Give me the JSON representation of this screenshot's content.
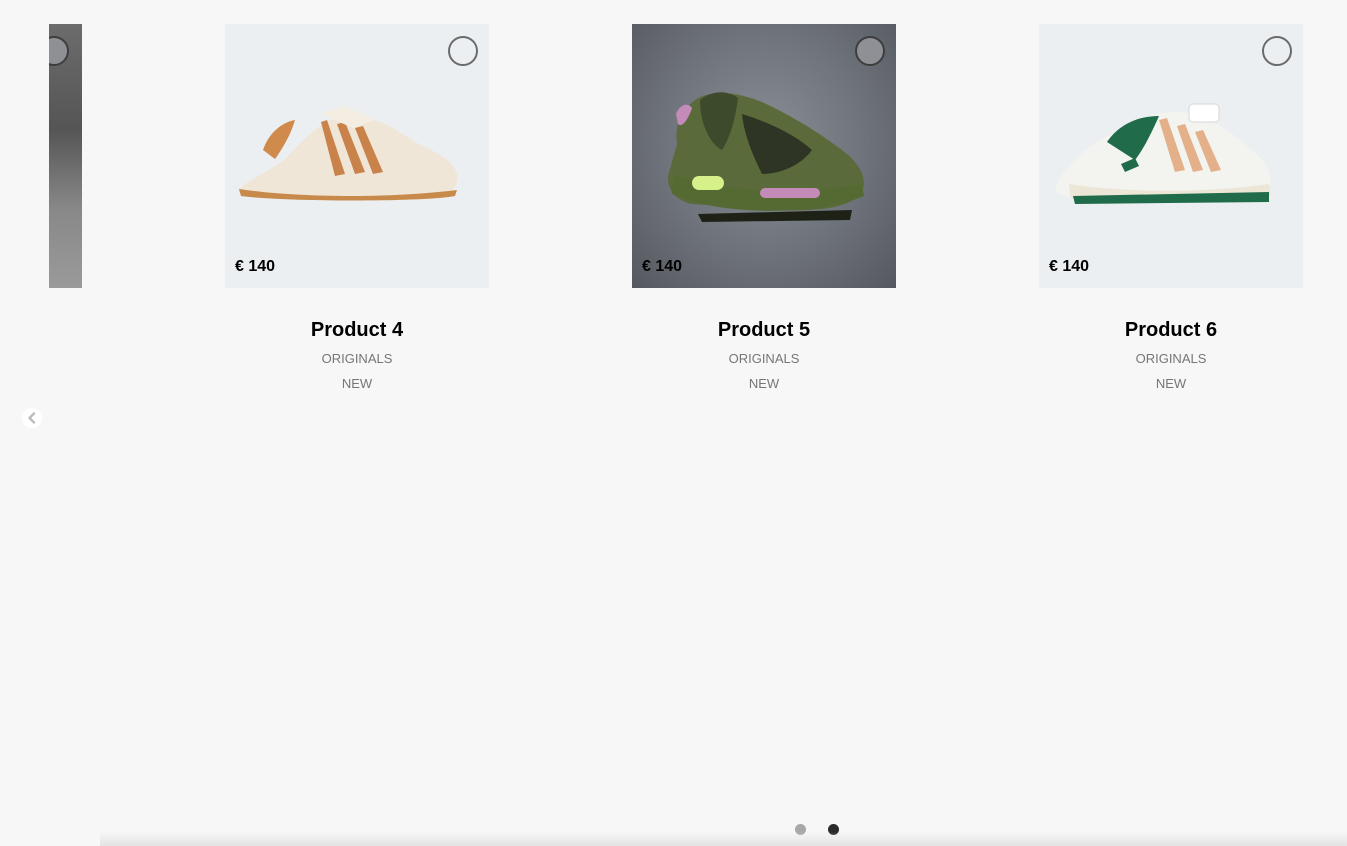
{
  "products": [
    {
      "name": "Product 4",
      "category": "ORIGINALS",
      "badge": "NEW",
      "price": "€ 140"
    },
    {
      "name": "Product 5",
      "category": "ORIGINALS",
      "badge": "NEW",
      "price": "€ 140"
    },
    {
      "name": "Product 6",
      "category": "ORIGINALS",
      "badge": "NEW",
      "price": "€ 140"
    }
  ],
  "icons": {
    "wishlist": "heart-icon",
    "prev": "chevron-left-icon"
  },
  "pagination": {
    "total": 2,
    "active_page": 2
  },
  "colors": {
    "background": "#f7f7f7",
    "image_background": "#eceff2",
    "secondary_text": "#767676",
    "dot_active": "#2b2b2b",
    "dot_inactive": "#a8a8a8"
  }
}
